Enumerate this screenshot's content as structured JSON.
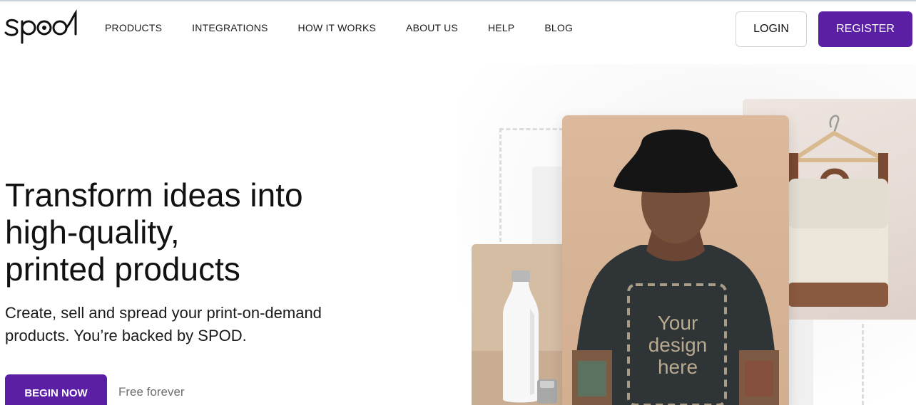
{
  "brand": {
    "logo_text": "spod"
  },
  "nav": {
    "items": [
      {
        "label": "PRODUCTS"
      },
      {
        "label": "INTEGRATIONS"
      },
      {
        "label": "HOW IT WORKS"
      },
      {
        "label": "ABOUT US"
      },
      {
        "label": "HELP"
      },
      {
        "label": "BLOG"
      }
    ],
    "login_label": "LOGIN",
    "register_label": "REGISTER"
  },
  "hero": {
    "title_lines": [
      "Transform ideas into",
      "high-quality,",
      "printed products"
    ],
    "subtitle_lines": [
      "Create, sell and spread your print-on-demand",
      "products. You’re backed by SPOD."
    ],
    "cta_label": "BEGIN NOW",
    "cta_note": "Free forever"
  },
  "collage": {
    "design_placeholder_lines": [
      "Your",
      "design",
      "here"
    ],
    "images": [
      "model-tshirt-image",
      "water-bottle-image",
      "backpack-on-hanger-image"
    ]
  },
  "colors": {
    "accent": "#5b1fa6",
    "muted_text": "#6e6e6e",
    "border": "#d4d4d4"
  }
}
